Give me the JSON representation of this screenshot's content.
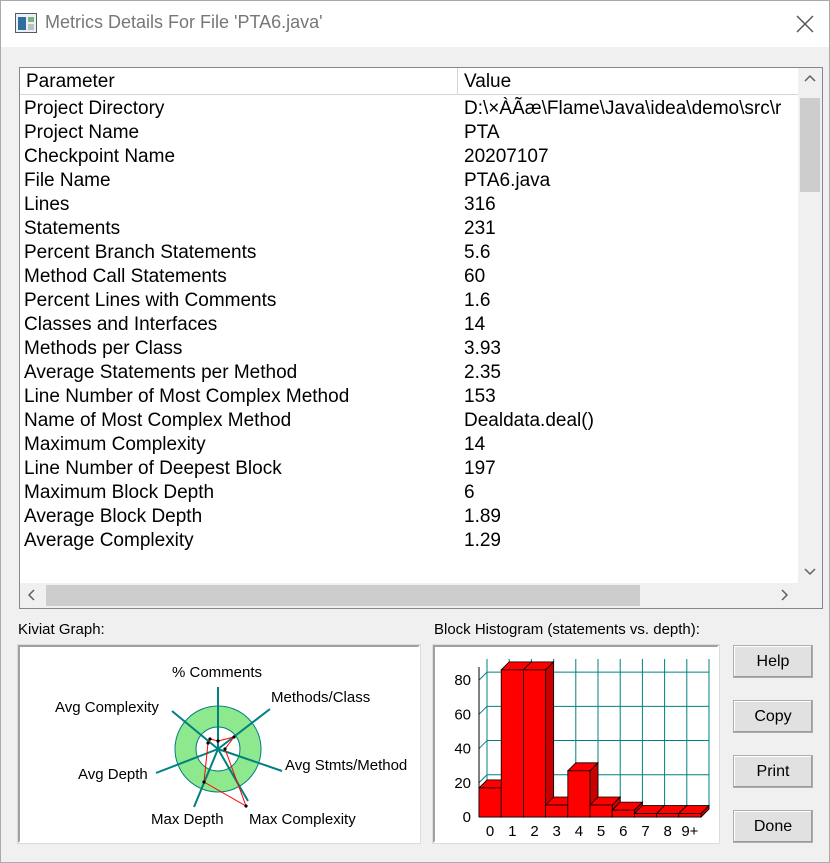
{
  "window": {
    "title": "Metrics Details For File 'PTA6.java'",
    "icons": {
      "app": "metrics-app-icon",
      "close": "close-icon"
    }
  },
  "table": {
    "columns": [
      "Parameter",
      "Value"
    ],
    "rows": [
      {
        "param": "Project Directory",
        "value": "D:\\×ÀÃæ\\Flame\\Java\\idea\\demo\\src\\r"
      },
      {
        "param": "Project Name",
        "value": "PTA"
      },
      {
        "param": "Checkpoint Name",
        "value": "20207107"
      },
      {
        "param": "File Name",
        "value": "PTA6.java"
      },
      {
        "param": "Lines",
        "value": "316"
      },
      {
        "param": "Statements",
        "value": "231"
      },
      {
        "param": "Percent Branch Statements",
        "value": "5.6"
      },
      {
        "param": "Method Call Statements",
        "value": "60"
      },
      {
        "param": "Percent Lines with Comments",
        "value": "1.6"
      },
      {
        "param": "Classes and Interfaces",
        "value": "14"
      },
      {
        "param": "Methods per Class",
        "value": "3.93"
      },
      {
        "param": "Average Statements per Method",
        "value": "2.35"
      },
      {
        "param": "Line Number of Most Complex Method",
        "value": "153"
      },
      {
        "param": "Name of Most Complex Method",
        "value": "Dealdata.deal()"
      },
      {
        "param": "Maximum Complexity",
        "value": "14"
      },
      {
        "param": "Line Number of Deepest Block",
        "value": "197"
      },
      {
        "param": "Maximum Block Depth",
        "value": "6"
      },
      {
        "param": "Average Block Depth",
        "value": "1.89"
      },
      {
        "param": "Average Complexity",
        "value": "1.29"
      }
    ]
  },
  "kiviat": {
    "label": "Kiviat Graph:",
    "axes": [
      "% Comments",
      "Methods/Class",
      "Avg Stmts/Method",
      "Max Complexity",
      "Max Depth",
      "Avg Depth",
      "Avg Complexity"
    ],
    "colors": {
      "ring": "#8ee88e",
      "line": "#ff0000",
      "spoke": "#008080"
    }
  },
  "histogram": {
    "label": "Block Histogram (statements vs. depth):",
    "colors": {
      "bar": "#ff0000",
      "grid": "#008080"
    }
  },
  "chart_data": {
    "type": "bar",
    "title": "Block Histogram (statements vs. depth):",
    "categories": [
      "0",
      "1",
      "2",
      "3",
      "4",
      "5",
      "6",
      "7",
      "8",
      "9+"
    ],
    "values": [
      17,
      86,
      86,
      7,
      27,
      7,
      4,
      2,
      2,
      2
    ],
    "ylim": [
      0,
      90
    ],
    "yticks": [
      "0",
      "20",
      "40",
      "60",
      "80"
    ],
    "grid": true
  },
  "buttons": {
    "help": "Help",
    "copy": "Copy",
    "print": "Print",
    "done": "Done"
  }
}
